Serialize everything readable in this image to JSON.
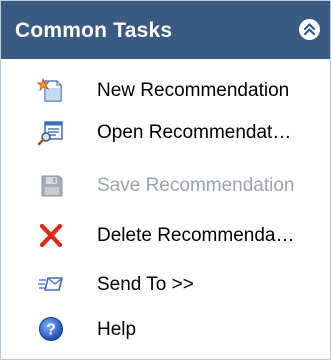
{
  "panel": {
    "title": "Common Tasks",
    "collapse_icon": "double-chevron-up-icon"
  },
  "tasks": [
    {
      "label": "New Recommendation",
      "icon": "new-document-sparkle-icon",
      "enabled": true
    },
    {
      "label": "Open Recommendat…",
      "icon": "open-search-document-icon",
      "enabled": true
    },
    {
      "label": "Save Recommendation",
      "icon": "save-disk-icon",
      "enabled": false
    },
    {
      "label": "Delete Recommenda…",
      "icon": "delete-x-icon",
      "enabled": true
    },
    {
      "label": "Send To >>",
      "icon": "send-to-icon",
      "enabled": true
    },
    {
      "label": "Help",
      "icon": "help-icon",
      "enabled": true
    }
  ],
  "colors": {
    "header_bg": "#3b5a82",
    "header_text": "#ffffff",
    "disabled_text": "#9ca3ad",
    "delete_red": "#e0281d",
    "help_blue": "#2860c8"
  }
}
